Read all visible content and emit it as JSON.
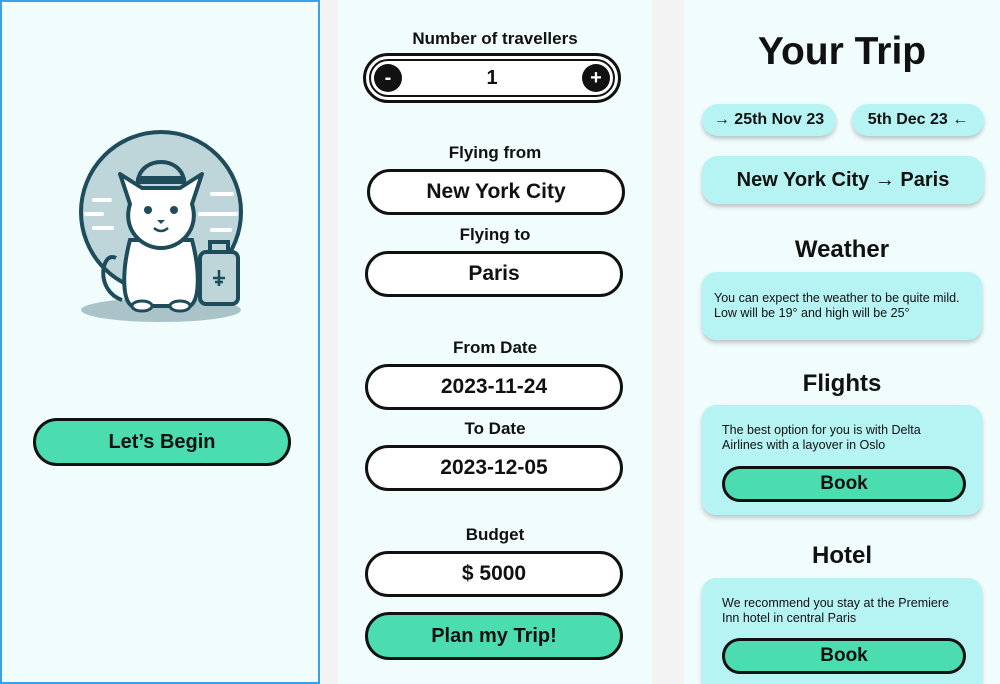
{
  "welcome": {
    "begin_button": "Let’s Begin"
  },
  "form": {
    "travellers_label": "Number of travellers",
    "travellers_value": "1",
    "minus_symbol": "-",
    "plus_symbol": "+",
    "from_label": "Flying from",
    "from_value": "New York City",
    "to_label": "Flying to",
    "to_value": "Paris",
    "from_date_label": "From Date",
    "from_date_value": "2023-11-24",
    "to_date_label": "To Date",
    "to_date_value": "2023-12-05",
    "budget_label": "Budget",
    "budget_value": "$ 5000",
    "plan_button": "Plan my Trip!"
  },
  "trip": {
    "title": "Your Trip",
    "depart_chip": "→ 25th Nov 23",
    "return_chip": "5th Dec 23 ←",
    "route": "New York City → Paris",
    "weather_title": "Weather",
    "weather_text": "You can expect the weather to be quite mild. Low will be 19° and high will be 25°",
    "flights_title": "Flights",
    "flights_text": "The best option for you is with Delta Airlines with a layover in Oslo",
    "flights_book": "Book",
    "hotel_title": "Hotel",
    "hotel_text": "We recommend you stay at the Premiere Inn hotel in central Paris",
    "hotel_book": "Book"
  },
  "colors": {
    "accent": "#4bdcb0",
    "card": "#b6f3f3",
    "screen_bg": "#f1fdfd",
    "selection_border": "#3aa0e8"
  },
  "icons": [
    "cat-pilot-mascot-icon",
    "suitcase-icon",
    "minus-icon",
    "plus-icon"
  ]
}
